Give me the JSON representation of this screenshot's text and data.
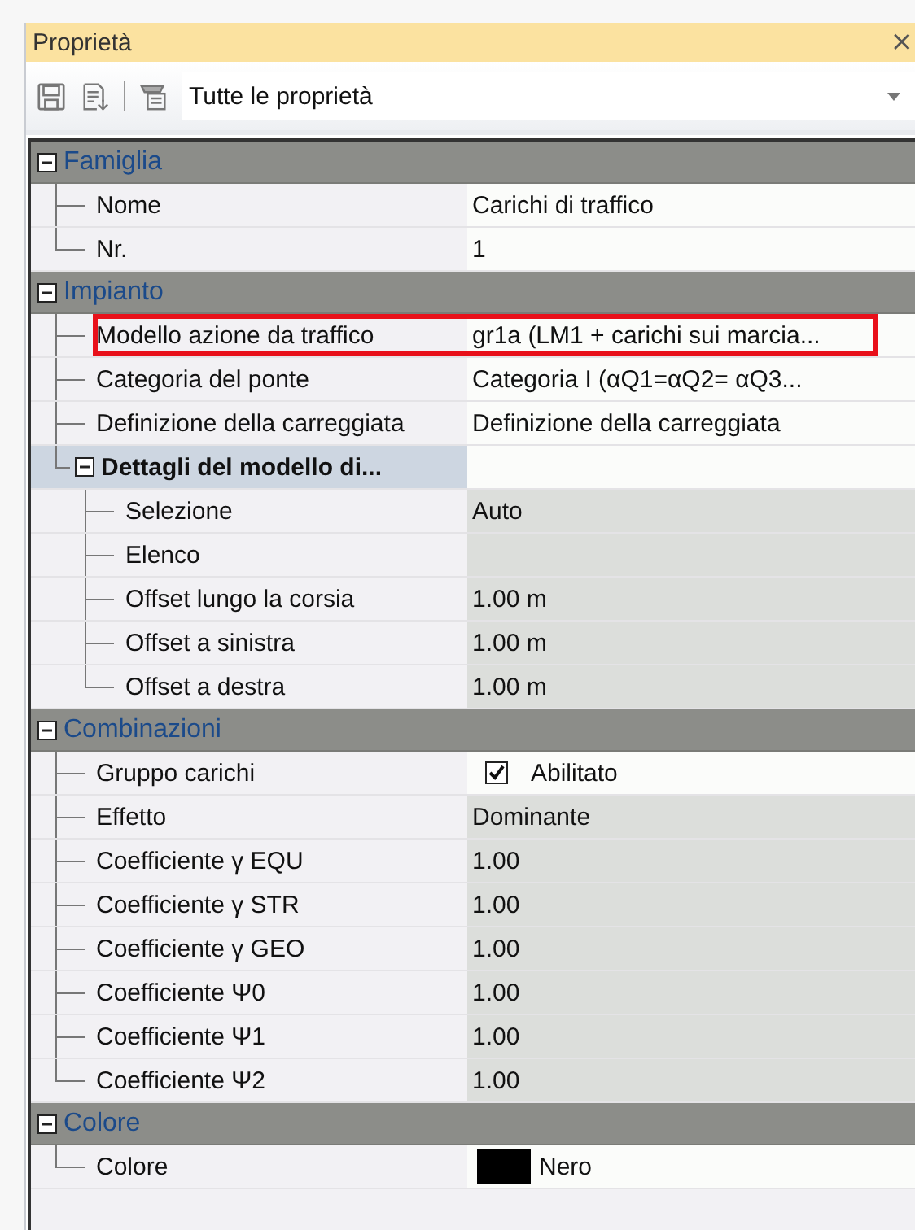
{
  "panel": {
    "title": "Proprietà",
    "close": "×"
  },
  "toolbar": {
    "filter": "Tutte le proprietà"
  },
  "categories": [
    {
      "label": "Famiglia",
      "expanded": true,
      "rows": [
        {
          "kind": "text",
          "name": "Nome",
          "value": "Carichi di traffico",
          "editable": true
        },
        {
          "kind": "text",
          "name": "Nr.",
          "value": "1",
          "editable": true
        }
      ]
    },
    {
      "label": "Impianto",
      "expanded": true,
      "rows": [
        {
          "kind": "text",
          "name": "Modello azione da traffico",
          "value": "gr1a (LM1 + carichi sui marcia...",
          "editable": true,
          "highlighted": true
        },
        {
          "kind": "text",
          "name": "Categoria del ponte",
          "value": "Categoria I (αQ1=αQ2= αQ3...",
          "editable": true
        },
        {
          "kind": "text",
          "name": "Definizione della carreggiata",
          "value": "Definizione della carreggiata",
          "editable": true
        },
        {
          "kind": "group",
          "name": "Dettagli del modello di...",
          "expanded": true,
          "children": [
            {
              "kind": "text",
              "name": "Selezione",
              "value": "Auto",
              "editable": false
            },
            {
              "kind": "text",
              "name": "Elenco",
              "editable": false
            },
            {
              "kind": "text",
              "name": "Offset lungo la corsia",
              "value": "1.00 m",
              "editable": false
            },
            {
              "kind": "text",
              "name": "Offset a sinistra",
              "value": "1.00 m",
              "editable": false
            },
            {
              "kind": "text",
              "name": "Offset a destra",
              "value": "1.00 m",
              "editable": false
            }
          ]
        }
      ]
    },
    {
      "label": "Combinazioni",
      "expanded": true,
      "rows": [
        {
          "kind": "checkbox",
          "name": "Gruppo carichi",
          "value": "Abilitato",
          "checked": true,
          "editable": true
        },
        {
          "kind": "text",
          "name": "Effetto",
          "value": "Dominante",
          "editable": false
        },
        {
          "kind": "text",
          "name": "Coefficiente γ EQU",
          "value": "1.00",
          "editable": false
        },
        {
          "kind": "text",
          "name": "Coefficiente γ STR",
          "value": "1.00",
          "editable": false
        },
        {
          "kind": "text",
          "name": "Coefficiente γ GEO",
          "value": "1.00",
          "editable": false
        },
        {
          "kind": "text",
          "name": "Coefficiente Ψ0",
          "value": "1.00",
          "editable": false
        },
        {
          "kind": "text",
          "name": "Coefficiente Ψ1",
          "value": "1.00",
          "editable": false
        },
        {
          "kind": "text",
          "name": "Coefficiente Ψ2",
          "value": "1.00",
          "editable": false
        }
      ]
    },
    {
      "label": "Colore",
      "expanded": true,
      "rows": [
        {
          "kind": "color",
          "name": "Colore",
          "value": "Nero",
          "color": "#000000",
          "editable": true
        }
      ]
    }
  ]
}
